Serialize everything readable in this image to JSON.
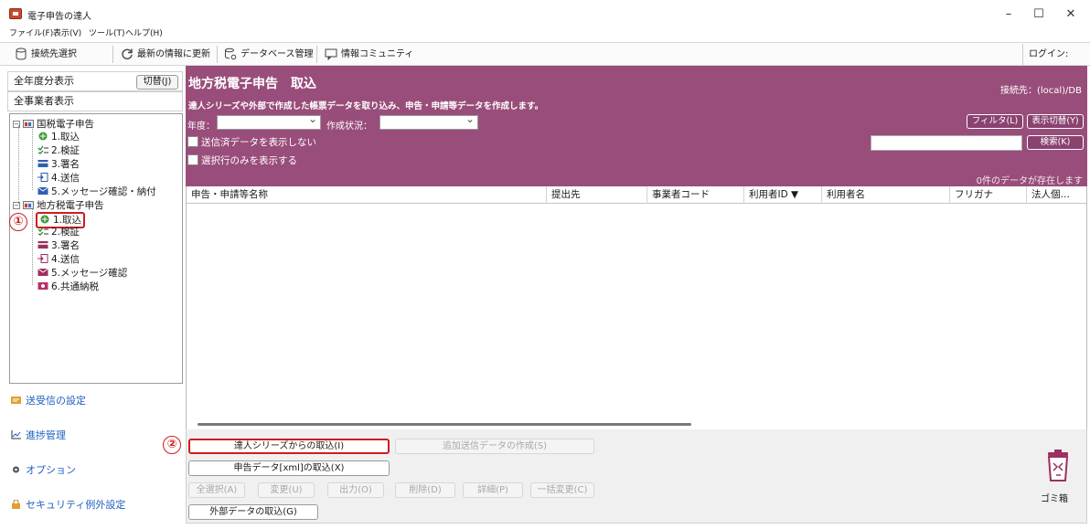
{
  "window": {
    "title": "電子申告の達人",
    "minimize": "–",
    "maximize": "☐",
    "close": "✕"
  },
  "menu": [
    {
      "label": "ファイル(F)"
    },
    {
      "label": "表示(V)"
    },
    {
      "label": "ツール(T)"
    },
    {
      "label": "ヘルプ(H)"
    }
  ],
  "toolbar": {
    "connect": "接続先選択",
    "refresh": "最新の情報に更新",
    "database": "データベース管理",
    "community": "情報コミュニティ",
    "login": "ログイン:"
  },
  "left": {
    "all_years": "全年度分表示",
    "switch": "切替(J)",
    "all_businesses": "全事業者表示",
    "tree": {
      "national": "国税電子申告",
      "national_items": [
        "1.取込",
        "2.検証",
        "3.署名",
        "4.送信",
        "5.メッセージ確認・納付"
      ],
      "local": "地方税電子申告",
      "local_items": [
        "1.取込",
        "2.検証",
        "3.署名",
        "4.送信",
        "5.メッセージ確認",
        "6.共通納税"
      ]
    },
    "links": {
      "send_settings": "送受信の設定",
      "progress": "進捗管理",
      "options": "オプション",
      "security": "セキュリティ例外設定"
    }
  },
  "main": {
    "title": "地方税電子申告　取込",
    "description": "達人シリーズや外部で作成した帳票データを取り込み、申告・申請等データを作成します。",
    "connection": "接続先：(local)/DB",
    "year_label": "年度：",
    "status_label": "作成状況：",
    "filter_btn": "フィルタ(L)",
    "display_switch_btn": "表示切替(Y)",
    "hide_sent": "送信済データを表示しない",
    "selected_only": "選択行のみを表示する",
    "search_btn": "検索(K)",
    "data_count": "0件のデータが存在します",
    "columns": [
      "申告・申請等名称",
      "提出先",
      "事業者コード",
      "利用者ID ▼",
      "利用者名",
      "フリガナ",
      "法人個…"
    ]
  },
  "bottom": {
    "import_series": "達人シリーズからの取込(I)",
    "create_additional": "追加送信データの作成(S)",
    "import_xml": "申告データ[xml]の取込(X)",
    "select_all": "全選択(A)",
    "change": "変更(U)",
    "output": "出力(O)",
    "delete": "削除(D)",
    "detail": "詳細(P)",
    "bulk_change": "一括変更(C)",
    "import_external": "外部データの取込(G)",
    "trash": "ゴミ箱"
  },
  "markers": {
    "one": "①",
    "two": "②"
  },
  "colors": {
    "header_bg": "#994d7a",
    "link": "#2060c0",
    "marker": "#d01c1c"
  }
}
